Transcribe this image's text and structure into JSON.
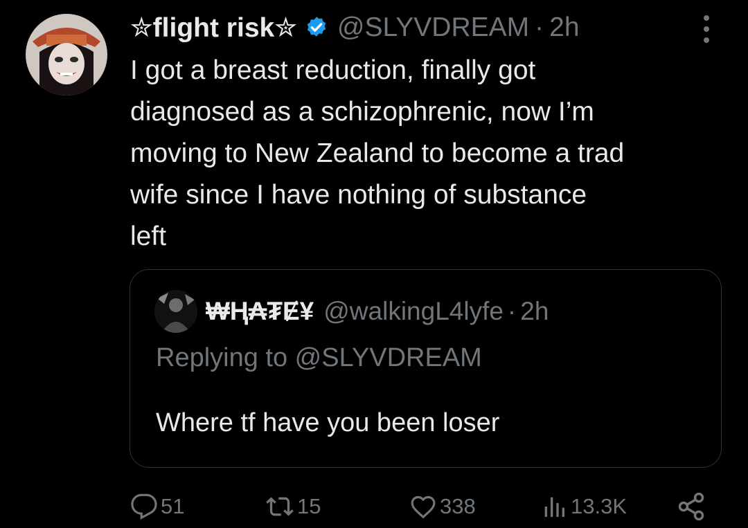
{
  "tweet": {
    "display_name": "✮flight risk✮",
    "handle": "@SLYVDREAM",
    "separator": "·",
    "time": "2h",
    "body_lines": [
      "I got a breast reduction, finally got",
      "diagnosed as a schizophrenic, now I’m",
      "moving to New Zealand to become a trad",
      "wife since I have nothing of substance",
      "left"
    ]
  },
  "quote": {
    "display_name": "₩Ⱨ₳₮Ɇ¥",
    "handle": "@walkingL4lyfe",
    "separator": "·",
    "time": "2h",
    "replying_to": "Replying to @SLYVDREAM",
    "text": "Where tf have you been loser"
  },
  "actions": {
    "replies": "51",
    "reposts": "15",
    "likes": "338",
    "views": "13.3K"
  },
  "icons": {
    "verified": "verified-badge-icon",
    "more": "more-vertical-icon",
    "reply": "reply-icon",
    "repost": "repost-icon",
    "like": "heart-icon",
    "views": "views-chart-icon",
    "share": "share-icon"
  },
  "colors": {
    "background": "#000000",
    "text": "#e7e9ea",
    "secondary": "#71767b",
    "verified": "#1d9bf0",
    "border": "#2f3336"
  }
}
